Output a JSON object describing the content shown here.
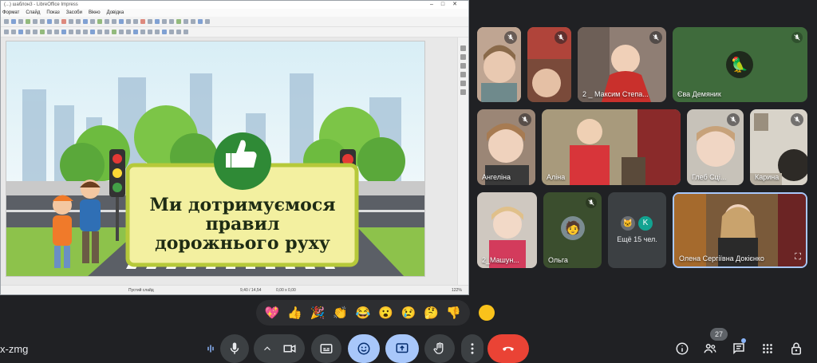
{
  "window": {
    "title": "(...) шаблон3 - LibreOffice Impress",
    "menu": [
      "Формат",
      "Слайд",
      "Показ",
      "Засоби",
      "Вікно",
      "Довідка"
    ],
    "status_slide": "Пустий слайд",
    "status_pos": "9,40 / 14,54",
    "status_size": "0,00 x 0,00",
    "zoom": "122%"
  },
  "slide": {
    "title_lines": [
      "Ми дотримуємося",
      "правил",
      "дорожнього руху"
    ]
  },
  "participants": [
    {
      "id": "p1",
      "name": ""
    },
    {
      "id": "p2",
      "name": ""
    },
    {
      "id": "p3",
      "name": "2 _ Максим Степа..."
    },
    {
      "id": "p4",
      "name": "Єва Демяник"
    },
    {
      "id": "p5",
      "name": "Ангеліна"
    },
    {
      "id": "p6",
      "name": "Аліна"
    },
    {
      "id": "p7",
      "name": "Глеб Сці..."
    },
    {
      "id": "p8",
      "name": "Карина"
    },
    {
      "id": "p9",
      "name": "2_Машун..."
    },
    {
      "id": "p10",
      "name": "Ольга"
    },
    {
      "id": "p11",
      "name": "Ещё 15 чел.",
      "avatar_letter": "K"
    },
    {
      "id": "p12",
      "name": "Олена Сергіївна Докієнко"
    }
  ],
  "reactions": [
    "💖",
    "👍",
    "🎉",
    "👏",
    "😂",
    "😮",
    "😢",
    "🤔",
    "👎"
  ],
  "meeting_code": "x-zmg",
  "participant_count": "27",
  "colors": {
    "end_call": "#ea4335",
    "active_control": "#a8c7fa",
    "background": "#202124"
  }
}
